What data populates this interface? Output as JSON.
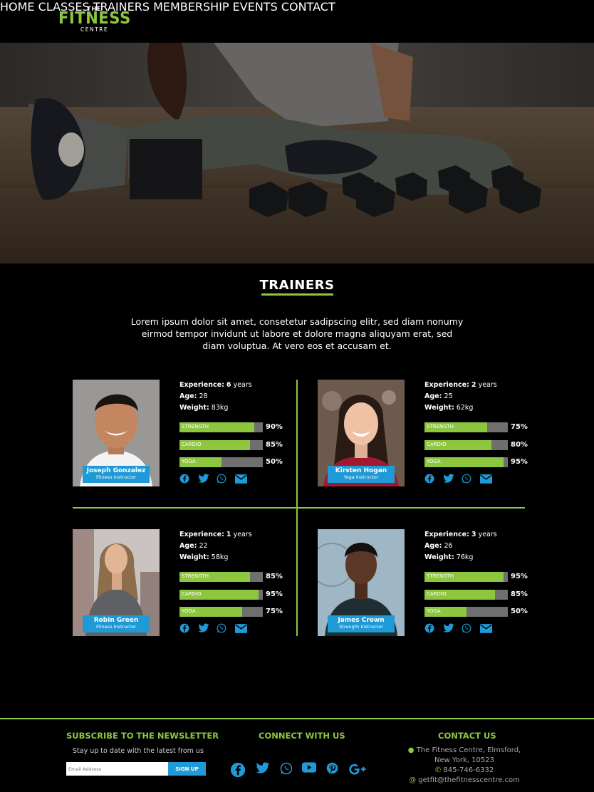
{
  "brand": {
    "the": "THE",
    "name": "FITNESS",
    "centre": "CENTRE",
    "accent": "#8dc63f",
    "blue": "#1f9ad6"
  },
  "nav": {
    "items": [
      "HOME",
      "CLASSES",
      "TRAINERS",
      "MEMBERSHIP",
      "EVENTS",
      "CONTACT"
    ]
  },
  "trainers_section": {
    "title": "TRAINERS",
    "intro": "Lorem ipsum dolor sit amet, consetetur sadipscing elitr, sed diam nonumy eirmod tempor invidunt ut labore et dolore magna aliquyam erat, sed diam voluptua. At vero eos et accusam et."
  },
  "trainers": [
    {
      "name": "Joseph Gonzalez",
      "role": "Fitness Instructor",
      "experience_label": "Experience:",
      "experience_value": "6",
      "experience_unit": "years",
      "age_label": "Age:",
      "age": "28",
      "weight_label": "Weight:",
      "weight": "83kg",
      "skills": [
        {
          "name": "STRENGTH",
          "value": 90,
          "display": "90%"
        },
        {
          "name": "CARDIO",
          "value": 85,
          "display": "85%"
        },
        {
          "name": "YOGA",
          "value": 50,
          "display": "50%"
        }
      ]
    },
    {
      "name": "Kirsten Hogan",
      "role": "Yoga Instructor",
      "experience_label": "Experience:",
      "experience_value": "2",
      "experience_unit": "years",
      "age_label": "Age:",
      "age": "25",
      "weight_label": "Weight:",
      "weight": "62kg",
      "skills": [
        {
          "name": "STRENGTH",
          "value": 75,
          "display": "75%"
        },
        {
          "name": "CARDIO",
          "value": 80,
          "display": "80%"
        },
        {
          "name": "YOGA",
          "value": 95,
          "display": "95%"
        }
      ]
    },
    {
      "name": "Robin Green",
      "role": "Fitness Instructor",
      "experience_label": "Experience:",
      "experience_value": "1",
      "experience_unit": "years",
      "age_label": "Age:",
      "age": "22",
      "weight_label": "Weight:",
      "weight": "58kg",
      "skills": [
        {
          "name": "STRENGTH",
          "value": 85,
          "display": "85%"
        },
        {
          "name": "CARDIO",
          "value": 95,
          "display": "95%"
        },
        {
          "name": "YOGA",
          "value": 75,
          "display": "75%"
        }
      ]
    },
    {
      "name": "James Crown",
      "role": "Strength Instructor",
      "experience_label": "Experience:",
      "experience_value": "3",
      "experience_unit": "years",
      "age_label": "Age:",
      "age": "26",
      "weight_label": "Weight:",
      "weight": "76kg",
      "skills": [
        {
          "name": "STRENGTH",
          "value": 95,
          "display": "95%"
        },
        {
          "name": "CARDIO",
          "value": 85,
          "display": "85%"
        },
        {
          "name": "YOGA",
          "value": 50,
          "display": "50%"
        }
      ]
    }
  ],
  "trainer_socials": [
    "facebook-icon",
    "twitter-icon",
    "whatsapp-icon",
    "mail-icon"
  ],
  "footer": {
    "newsletter_title": "SUBSCRIBE TO THE NEWSLETTER",
    "newsletter_sub": "Stay up to date with the latest from us",
    "email_placeholder": "Email Address",
    "signup_label": "SIGN UP",
    "connect_title": "CONNECT WITH US",
    "connect_icons": [
      "facebook-icon",
      "twitter-icon",
      "whatsapp-icon",
      "youtube-icon",
      "pinterest-icon",
      "google-plus-icon"
    ],
    "contact_title": "CONTACT US",
    "address_line1": "The Fitness Centre, Elmsford,",
    "address_line2": "New York, 10523",
    "phone": "845-746-6332",
    "email": "getfit@thefitnesscentre.com"
  }
}
